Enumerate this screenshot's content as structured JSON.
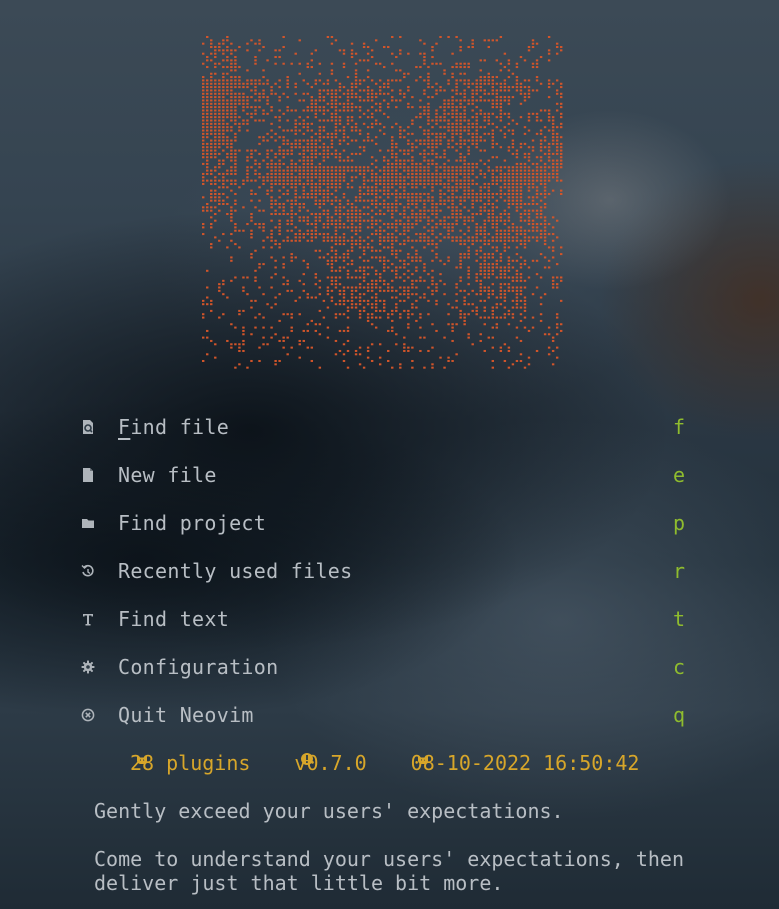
{
  "logo": {
    "name": "neovim-braille-logo",
    "color": "#d2552a"
  },
  "menu": {
    "items": [
      {
        "first": "F",
        "rest": "ind file",
        "key": "f",
        "icon": "search-file-icon"
      },
      {
        "first": "",
        "rest": "New file",
        "key": "e",
        "icon": "file-icon"
      },
      {
        "first": "",
        "rest": "Find project",
        "key": "p",
        "icon": "folder-icon"
      },
      {
        "first": "",
        "rest": "Recently used files",
        "key": "r",
        "icon": "history-icon"
      },
      {
        "first": "",
        "rest": "Find text",
        "key": "t",
        "icon": "text-icon"
      },
      {
        "first": "",
        "rest": "Configuration",
        "key": "c",
        "icon": "gear-icon"
      },
      {
        "first": "",
        "rest": "Quit Neovim",
        "key": "q",
        "icon": "close-circle-icon"
      }
    ]
  },
  "footer": {
    "plugins": "28 plugins",
    "version": "v0.7.0",
    "datetime": "08-10-2022 16:50:42",
    "icons": [
      "cat-icon",
      "info-icon",
      "cat-icon"
    ]
  },
  "quote": {
    "line1": "Gently exceed your users' expectations.",
    "line2": "Come to understand your users' expectations, then",
    "line3": "deliver just that little bit more."
  },
  "colors": {
    "accent_key": "#8fbc2e",
    "footer": "#d7a62a",
    "text": "#b8bec4",
    "logo": "#d2552a"
  }
}
